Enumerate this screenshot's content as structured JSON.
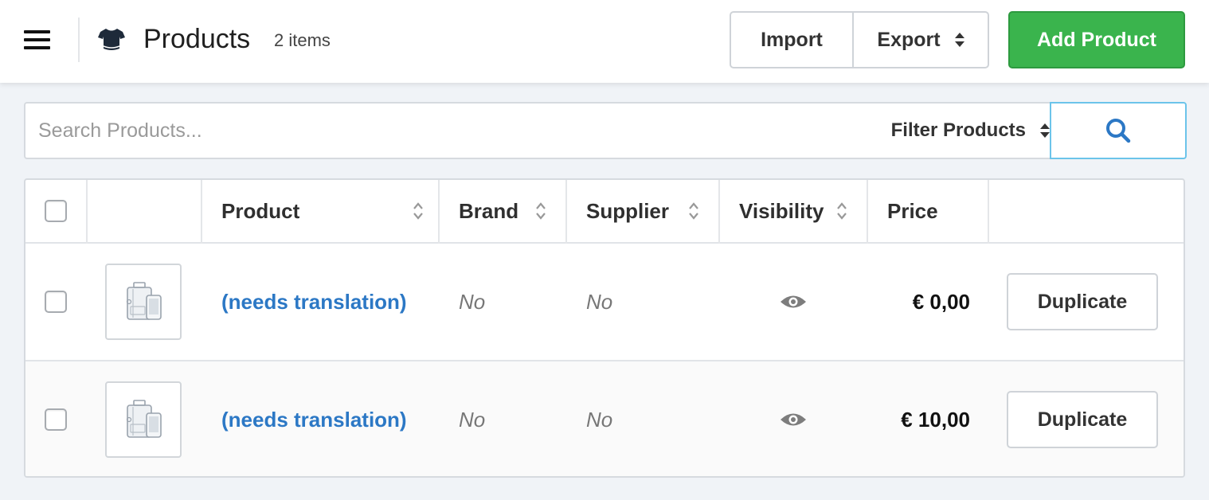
{
  "header": {
    "title": "Products",
    "item_count": "2 items",
    "icon": "tshirt-icon",
    "import_label": "Import",
    "export_label": "Export",
    "add_label": "Add Product",
    "add_color": "#3ab44d"
  },
  "search": {
    "placeholder": "Search Products...",
    "value": "",
    "filter_label": "Filter Products"
  },
  "table": {
    "columns": [
      "",
      "",
      "Product",
      "Brand",
      "Supplier",
      "Visibility",
      "Price",
      ""
    ],
    "sortable": [
      "Product",
      "Brand",
      "Supplier",
      "Visibility"
    ],
    "rows": [
      {
        "name": "(needs translation)",
        "brand": "No",
        "supplier": "No",
        "visibility": "eye-icon",
        "price": "€ 0,00",
        "action": "Duplicate"
      },
      {
        "name": "(needs translation)",
        "brand": "No",
        "supplier": "No",
        "visibility": "eye-icon",
        "price": "€ 10,00",
        "action": "Duplicate"
      }
    ]
  },
  "colors": {
    "link": "#2c78c5",
    "search_accent": "#6cc4ea"
  }
}
